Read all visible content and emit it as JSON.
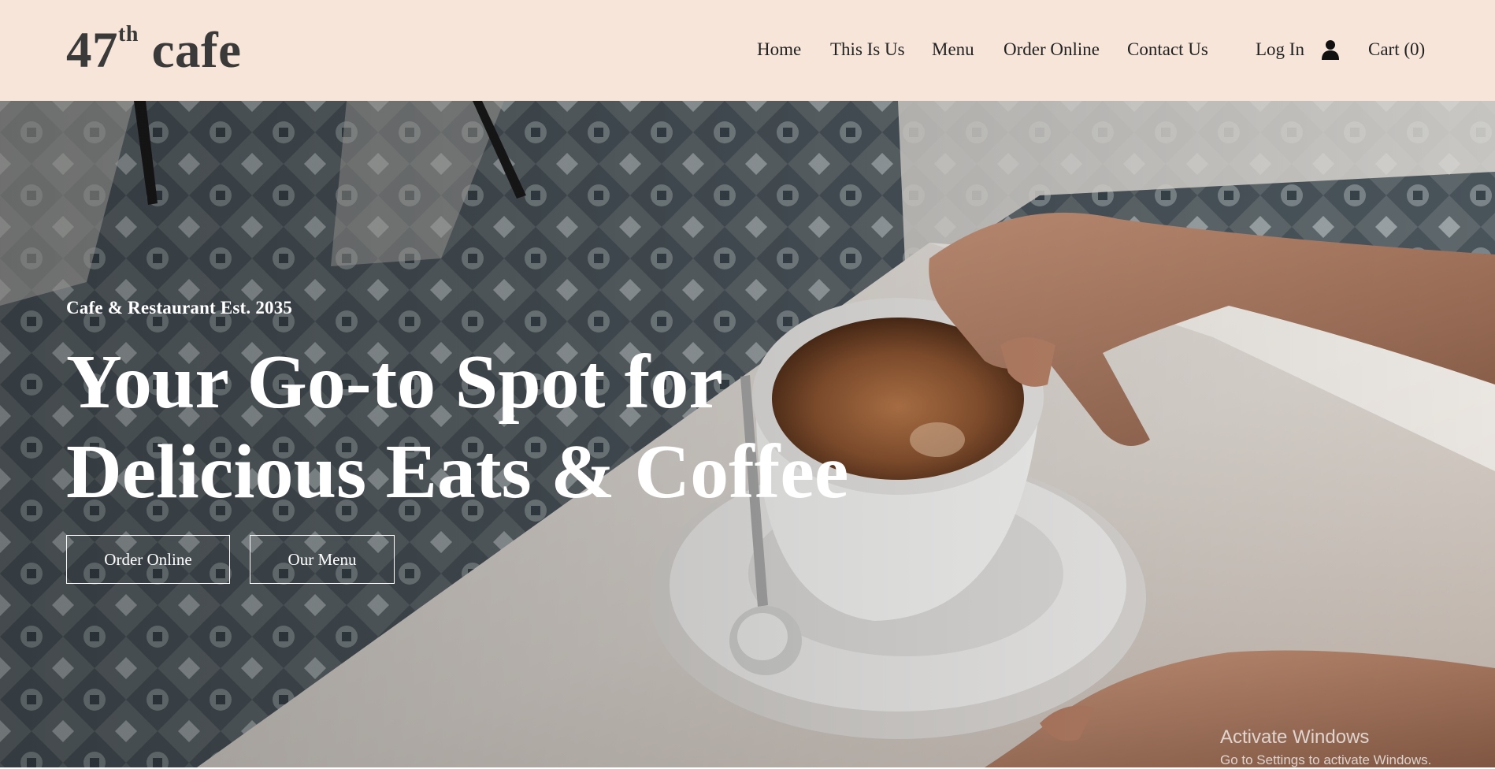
{
  "logo": {
    "main": "47",
    "sup": "th",
    "rest": " cafe"
  },
  "nav": {
    "items": [
      "Home",
      "This Is Us",
      "Menu",
      "Order Online",
      "Contact Us"
    ],
    "login_label": "Log In",
    "cart_label": "Cart (0)"
  },
  "hero": {
    "eyebrow": "Cafe & Restaurant Est. 2035",
    "title_line1": "Your Go-to Spot for",
    "title_line2": "Delicious Eats & Coffee",
    "buttons": [
      "Order Online",
      "Our Menu"
    ]
  },
  "watermark": {
    "title": "Activate Windows",
    "subtitle": "Go to Settings to activate Windows."
  },
  "colors": {
    "header_bg": "#f6e5d8",
    "text_dark": "#222222",
    "hero_text": "#ffffff"
  },
  "icons": [
    "user-icon"
  ]
}
